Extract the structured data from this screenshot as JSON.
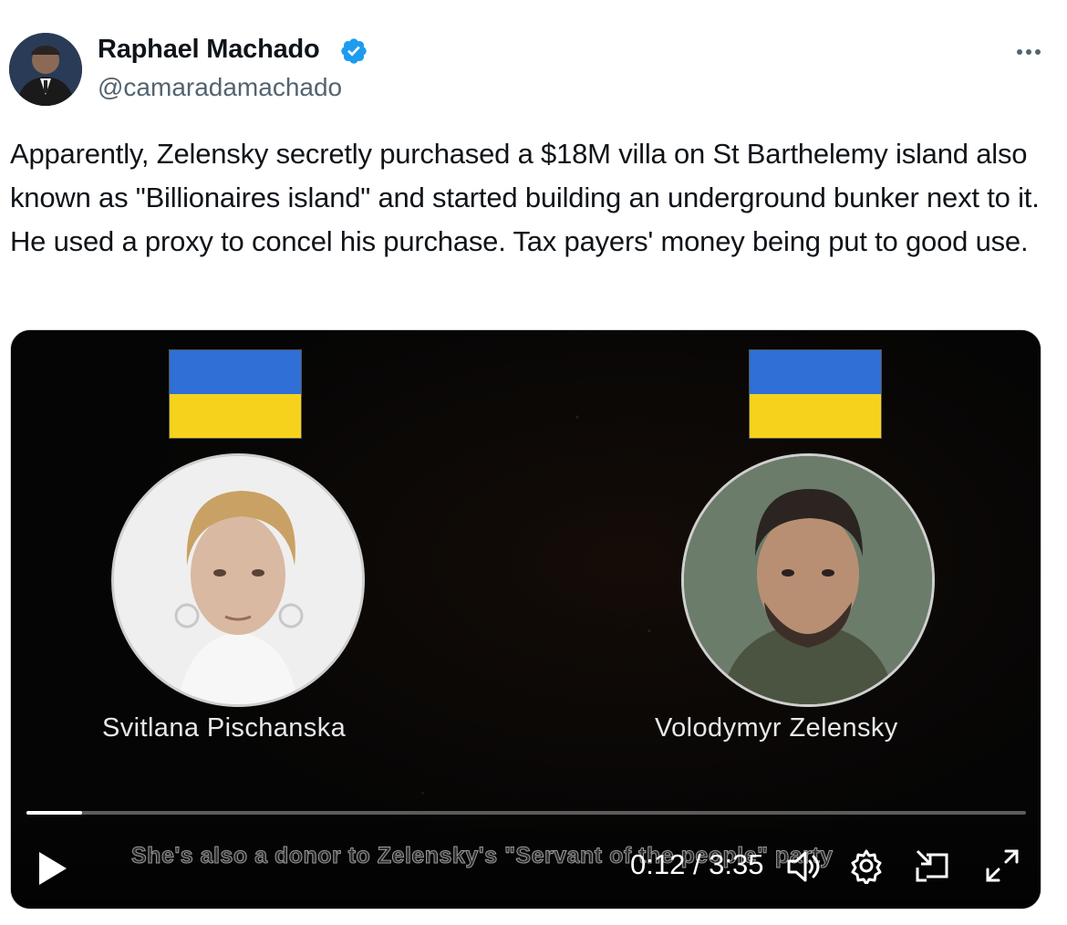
{
  "tweet": {
    "author": {
      "name": "Raphael Machado",
      "handle": "@camaradamachado",
      "verified": true
    },
    "more_icon": "ellipsis-icon",
    "text": "Apparently, Zelensky secretly purchased a $18M villa on St Barthelemy island also known as \"Billionaires island\" and started building an underground bunker next to it. He used a proxy to concel his purchase. Tax payers' money being put to good use."
  },
  "video": {
    "left_person": "Svitlana Pischanska",
    "right_person": "Volodymyr Zelensky",
    "subtitle": "She's also a donor to Zelensky's \"Servant of the people\" party",
    "time": "0:12 / 3:35",
    "progress_fraction": 0.056,
    "controls": [
      "play-icon",
      "volume-icon",
      "settings-icon",
      "dock-icon",
      "fullscreen-icon"
    ]
  },
  "colors": {
    "verified": "#1d9bf0",
    "flag_blue": "#2f6fd6",
    "flag_yellow": "#f7d21c",
    "secondary_text": "#536471"
  }
}
